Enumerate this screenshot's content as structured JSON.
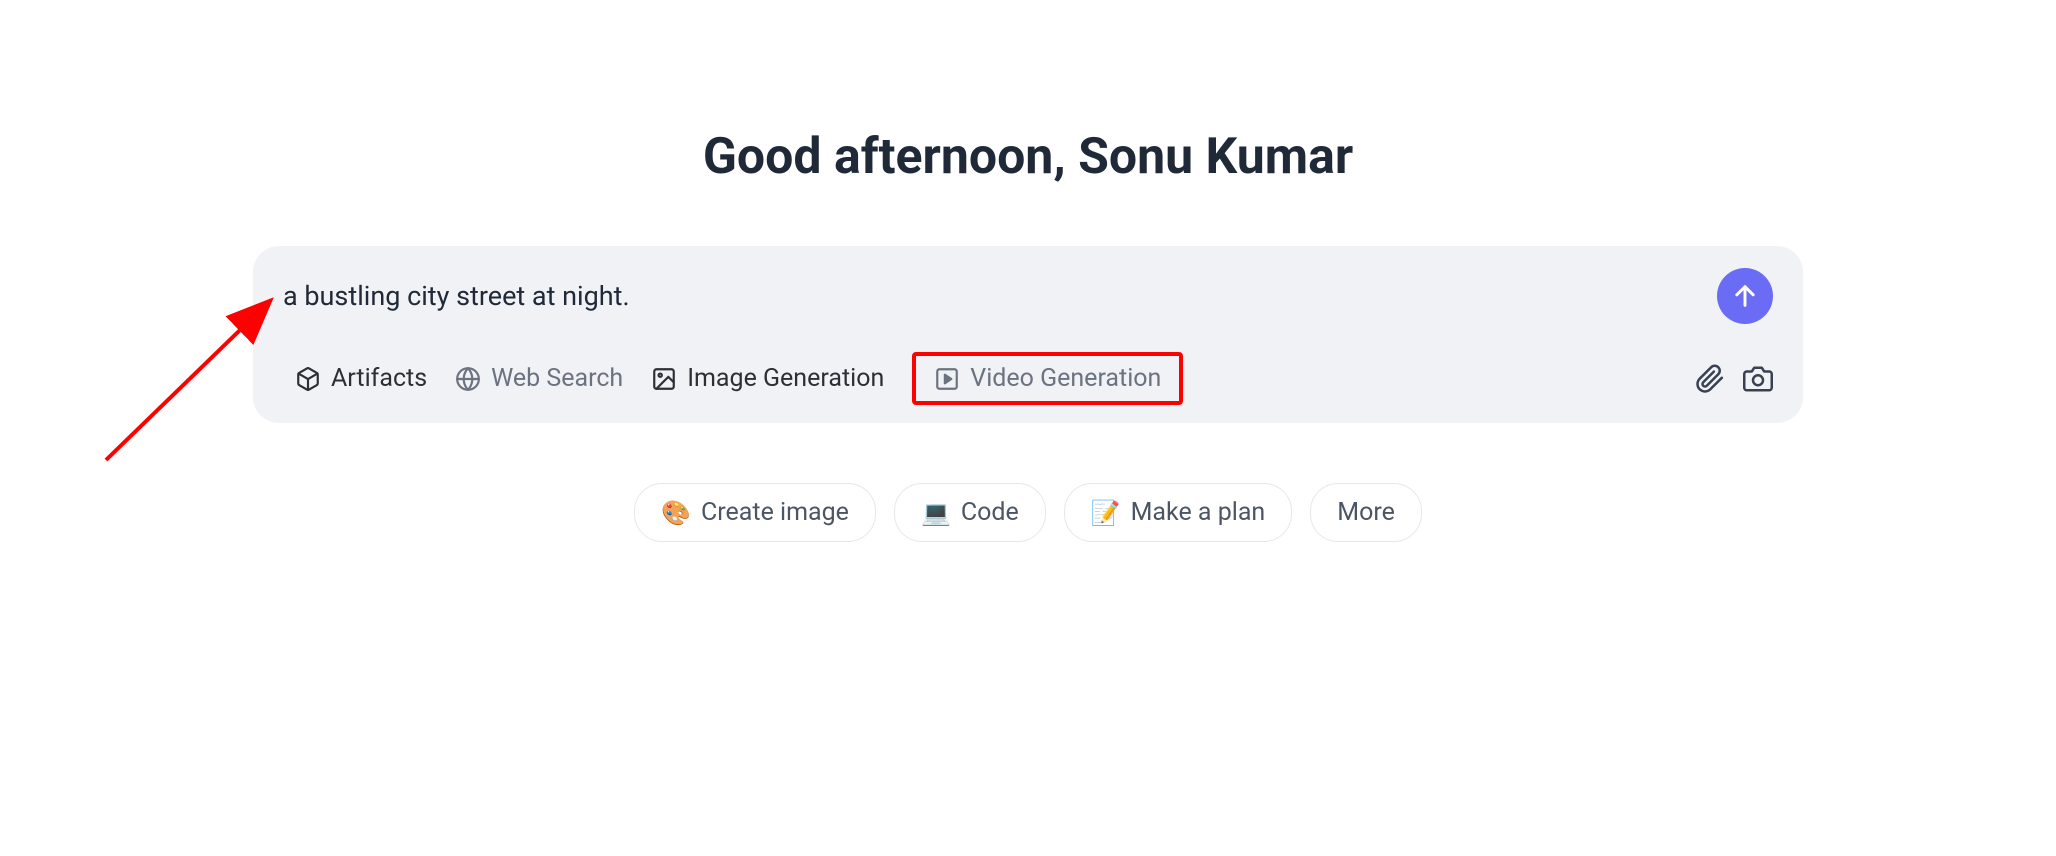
{
  "greeting": "Good afternoon, Sonu Kumar",
  "prompt": {
    "value": "a bustling city street at night."
  },
  "tools": {
    "artifacts": "Artifacts",
    "web_search": "Web Search",
    "image_generation": "Image Generation",
    "video_generation": "Video Generation"
  },
  "suggestions": {
    "create_image": {
      "emoji": "🎨",
      "label": "Create image"
    },
    "code": {
      "emoji": "💻",
      "label": "Code"
    },
    "make_plan": {
      "emoji": "📝",
      "label": "Make a plan"
    },
    "more": {
      "label": "More"
    }
  }
}
